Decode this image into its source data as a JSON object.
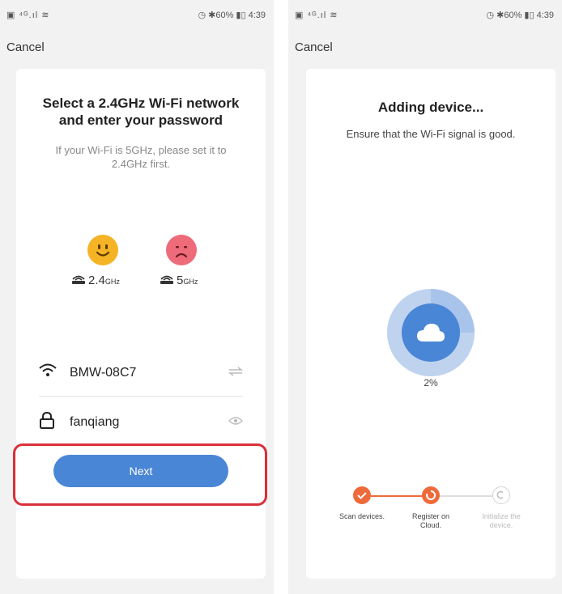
{
  "left": {
    "status": {
      "left": "▣ ⁴ᴳ.ıl ≋",
      "right": "◷ ✱60% ▮▯ 4:39"
    },
    "cancel_label": "Cancel",
    "title": "Select a 2.4GHz Wi-Fi network and enter your password",
    "subtitle": "If your Wi-Fi is 5GHz, please set it to 2.4GHz first.",
    "band_good": {
      "value": "2.4",
      "unit": "GHz"
    },
    "band_bad": {
      "value": "5",
      "unit": "GHz"
    },
    "wifi_name": "BMW-08C7",
    "password": "fanqiang",
    "next_label": "Next",
    "icons": [
      "happy-face-icon",
      "sad-face-icon",
      "router-icon",
      "wifi-icon",
      "switch-network-icon",
      "lock-icon",
      "eye-icon"
    ],
    "colors": {
      "primary": "#4a86d6",
      "highlight": "#d9303a",
      "good": "#f5b326",
      "bad": "#ee6b7a"
    }
  },
  "right": {
    "status": {
      "left": "▣ ⁴ᴳ.ıl ≋",
      "right": "◷ ✱60% ▮▯ 4:39"
    },
    "cancel_label": "Cancel",
    "title": "Adding device...",
    "subtitle": "Ensure that the Wi-Fi signal is good.",
    "progress_text": "2%",
    "progress_value": 0.02,
    "steps": [
      {
        "label": "Scan devices.",
        "state": "done"
      },
      {
        "label": "Register on Cloud.",
        "state": "active"
      },
      {
        "label": "Initialize the device.",
        "state": "pending"
      }
    ],
    "icons": [
      "cloud-icon",
      "check-icon",
      "loading-icon",
      "pending-icon"
    ],
    "colors": {
      "step_active": "#ef6a3a",
      "ring_outer": "#bed3ef",
      "ring_inner": "#4a86d6"
    }
  }
}
